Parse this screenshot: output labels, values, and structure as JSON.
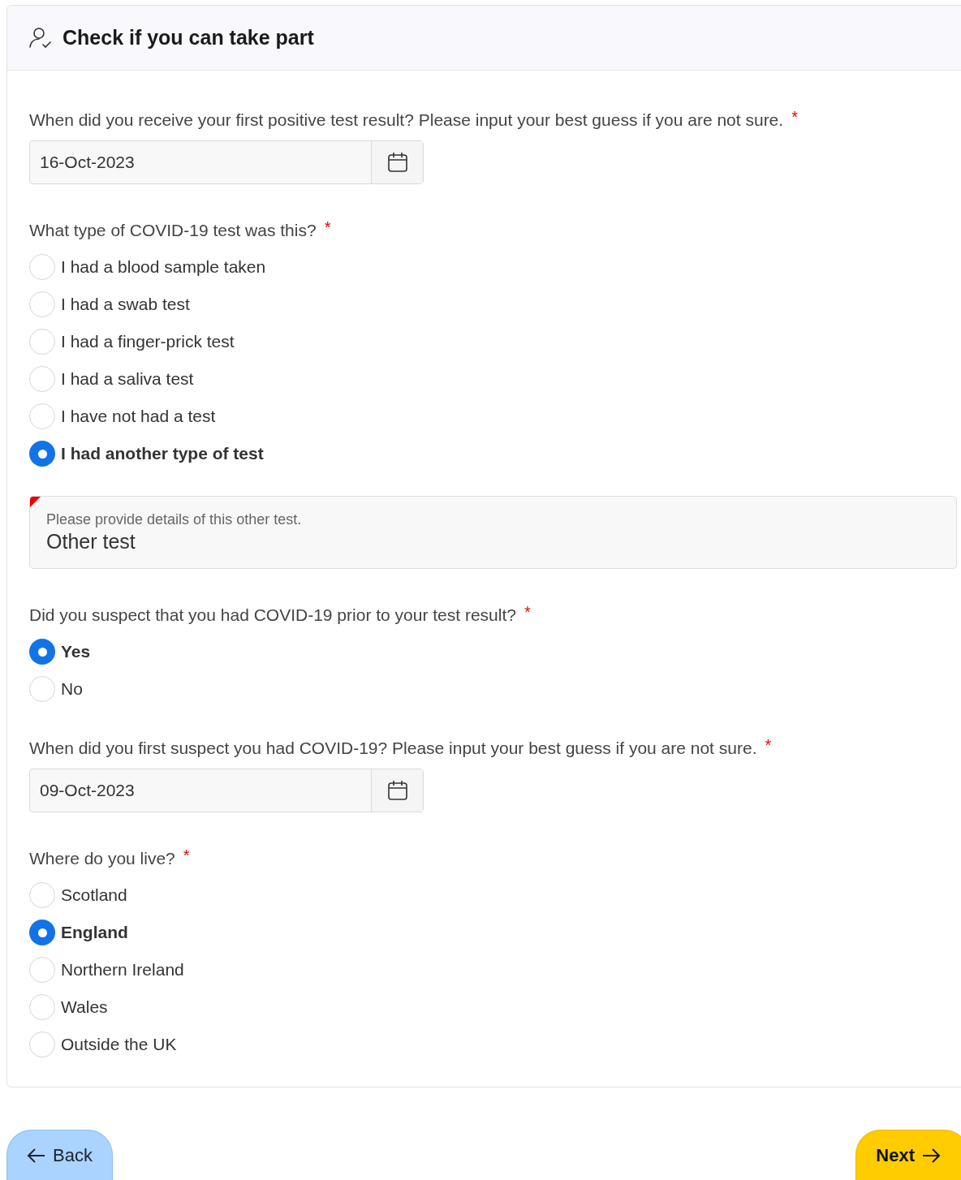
{
  "header": {
    "title": "Check if you can take part"
  },
  "questions": [
    {
      "kind": "date",
      "label": "When did you receive your first positive test result? Please input your best guess if you are not sure.",
      "required": "*",
      "value": "16-Oct-2023"
    },
    {
      "kind": "radio",
      "label": "What type of COVID-19 test was this?",
      "required": "*",
      "options": [
        {
          "label": "I had a blood sample taken",
          "selected": false
        },
        {
          "label": "I had a swab test",
          "selected": false
        },
        {
          "label": "I had a finger-prick test",
          "selected": false
        },
        {
          "label": "I had a saliva test",
          "selected": false
        },
        {
          "label": "I have not had a test",
          "selected": false
        },
        {
          "label": "I had another type of test",
          "selected": true
        }
      ],
      "details": {
        "label": "Please provide details of this other test.",
        "value": "Other test"
      }
    },
    {
      "kind": "radio",
      "label": "Did you suspect that you had COVID-19 prior to your test result?",
      "required": "*",
      "options": [
        {
          "label": "Yes",
          "selected": true
        },
        {
          "label": "No",
          "selected": false
        }
      ]
    },
    {
      "kind": "date",
      "label": "When did you first suspect you had COVID-19? Please input your best guess if you are not sure.",
      "required": "*",
      "value": "09-Oct-2023"
    },
    {
      "kind": "radio",
      "label": "Where do you live?",
      "required": "*",
      "options": [
        {
          "label": "Scotland",
          "selected": false
        },
        {
          "label": "England",
          "selected": true
        },
        {
          "label": "Northern Ireland",
          "selected": false
        },
        {
          "label": "Wales",
          "selected": false
        },
        {
          "label": "Outside the UK",
          "selected": false
        }
      ]
    }
  ],
  "buttons": {
    "back": "Back",
    "next": "Next"
  }
}
